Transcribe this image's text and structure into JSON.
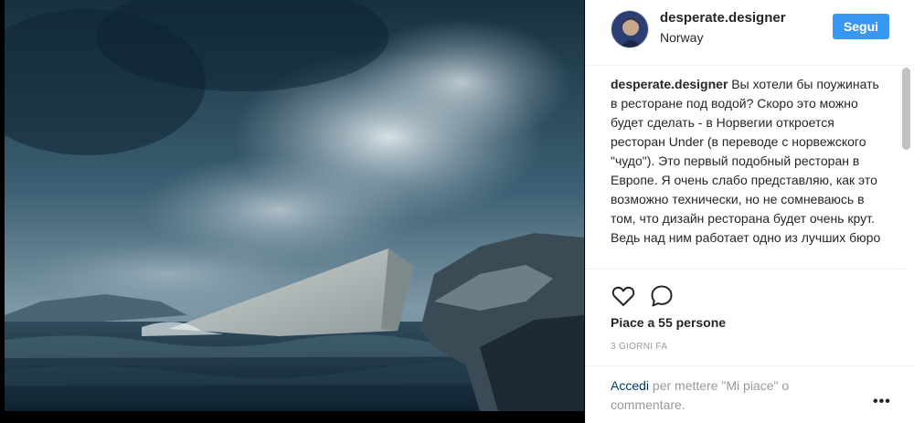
{
  "post": {
    "photo_alt": "Restaurant Under building in stormy sea",
    "author": "desperate.designer",
    "location": "Norway",
    "follow_label": "Segui"
  },
  "caption": {
    "user": "desperate.designer",
    "text": "Вы хотели бы поужинать в ресторане под водой? Скоро это можно будет сделать - в Норвегии откроется ресторан Under (в переводе с норвежского \"чудо\"). Это первый подобный ресторан в Европе. Я очень слабо представляю, как это возможно технически, но не сомневаюсь в том, что дизайн ресторана будет очень крут. Ведь над ним работает одно из лучших бюро"
  },
  "stats": {
    "likes": "Piace a 55 persone",
    "time_ago": "3 GIORNI FA"
  },
  "footer": {
    "login_link": "Accedi",
    "login_rest": " per mettere \"Mi piace\" o commentare.",
    "more": "•••"
  },
  "icons": {
    "like": "heart-outline-icon",
    "comment": "speech-bubble-icon",
    "more": "ellipsis-icon"
  },
  "colors": {
    "follow_bg": "#3897f0",
    "link": "#003569",
    "muted": "#999999"
  }
}
